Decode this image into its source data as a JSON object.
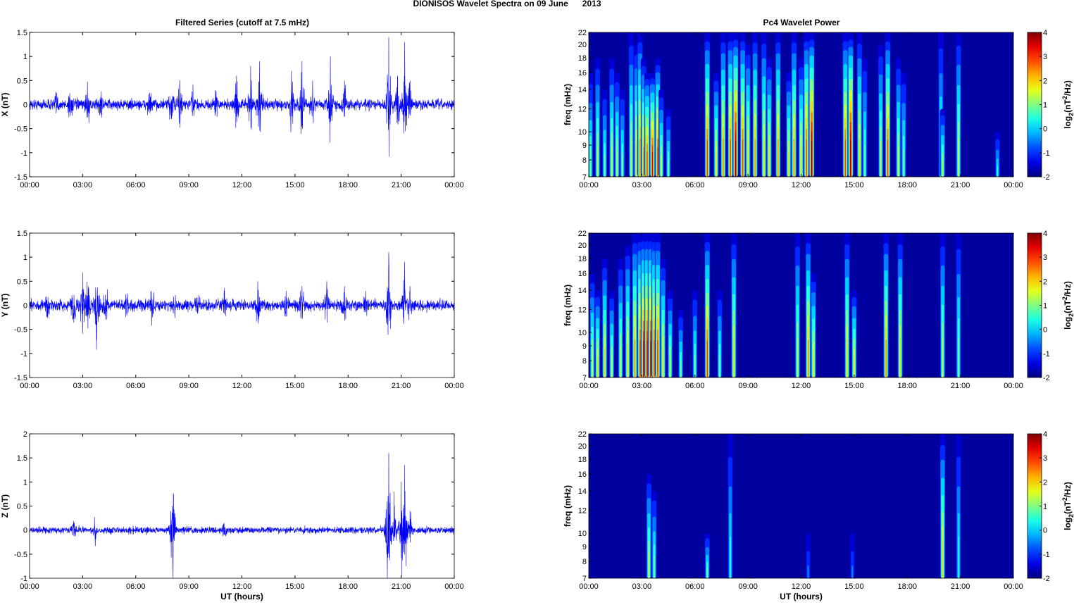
{
  "figure_title": "DIONISOS Wavelet Spectra on 09 June      2013",
  "chart_data": [
    {
      "type": "line",
      "title": "Filtered Series (cutoff at 7.5 mHz)",
      "xlabel": "",
      "ylabel": "X (nT)",
      "xlim": [
        0,
        24
      ],
      "ylim": [
        -1.5,
        1.5
      ],
      "yticks": [
        -1.5,
        -1,
        -0.5,
        0,
        0.5,
        1,
        1.5
      ],
      "xticklabels": [
        "00:00",
        "03:00",
        "06:00",
        "09:00",
        "12:00",
        "15:00",
        "18:00",
        "21:00",
        "00:00"
      ],
      "noise_level": 0.11,
      "color": "#0000ff",
      "bursts": [
        [
          1.5,
          0.3
        ],
        [
          2.3,
          0.4
        ],
        [
          3.3,
          0.45
        ],
        [
          4.0,
          0.3
        ],
        [
          6.8,
          0.3
        ],
        [
          8.0,
          0.5
        ],
        [
          8.5,
          0.8
        ],
        [
          9.2,
          0.4
        ],
        [
          10.5,
          0.3
        ],
        [
          11.7,
          0.6
        ],
        [
          12.5,
          0.8
        ],
        [
          13.0,
          0.9
        ],
        [
          14.8,
          0.7
        ],
        [
          15.4,
          0.9
        ],
        [
          16.0,
          0.5
        ],
        [
          17.0,
          1.0
        ],
        [
          17.8,
          0.5
        ],
        [
          20.3,
          1.4
        ],
        [
          20.8,
          0.6
        ],
        [
          21.2,
          1.3
        ],
        [
          21.5,
          0.5
        ]
      ]
    },
    {
      "type": "line",
      "title": "",
      "xlabel": "",
      "ylabel": "Y (nT)",
      "xlim": [
        0,
        24
      ],
      "ylim": [
        -1.5,
        1.5
      ],
      "yticks": [
        -1.5,
        -1,
        -0.5,
        0,
        0.5,
        1,
        1.5
      ],
      "xticklabels": [
        "00:00",
        "03:00",
        "06:00",
        "09:00",
        "12:00",
        "15:00",
        "18:00",
        "21:00",
        "00:00"
      ],
      "noise_level": 0.11,
      "color": "#0000ff",
      "bursts": [
        [
          1.0,
          0.4
        ],
        [
          2.5,
          0.6
        ],
        [
          3.0,
          0.7
        ],
        [
          3.3,
          0.8
        ],
        [
          3.8,
          1.2
        ],
        [
          4.3,
          0.5
        ],
        [
          5.5,
          0.3
        ],
        [
          6.9,
          0.7
        ],
        [
          8.2,
          0.3
        ],
        [
          9.5,
          0.3
        ],
        [
          11.0,
          0.3
        ],
        [
          12.9,
          0.5
        ],
        [
          14.5,
          0.3
        ],
        [
          15.4,
          0.4
        ],
        [
          16.8,
          0.5
        ],
        [
          17.8,
          0.4
        ],
        [
          19.0,
          0.3
        ],
        [
          20.3,
          1.1
        ],
        [
          21.2,
          0.9
        ],
        [
          21.5,
          0.4
        ]
      ]
    },
    {
      "type": "line",
      "title": "",
      "xlabel": "UT (hours)",
      "ylabel": "Z (nT)",
      "xlim": [
        0,
        24
      ],
      "ylim": [
        -1,
        2
      ],
      "yticks": [
        -1,
        -0.5,
        0,
        0.5,
        1,
        1.5,
        2
      ],
      "xticklabels": [
        "00:00",
        "03:00",
        "06:00",
        "09:00",
        "12:00",
        "15:00",
        "18:00",
        "21:00",
        "00:00"
      ],
      "noise_level": 0.07,
      "color": "#0000ff",
      "bursts": [
        [
          2.5,
          0.2
        ],
        [
          3.7,
          0.3
        ],
        [
          8.1,
          1.4
        ],
        [
          11.0,
          0.15
        ],
        [
          20.2,
          0.6
        ],
        [
          20.3,
          1.6
        ],
        [
          20.6,
          0.8
        ],
        [
          21.0,
          1.0
        ],
        [
          21.2,
          1.35
        ],
        [
          21.5,
          0.4
        ]
      ]
    },
    {
      "type": "heatmap",
      "title": "Pc4 Wavelet Power",
      "xlabel": "",
      "ylabel": "freq (mHz)",
      "xlim": [
        0,
        24
      ],
      "ylim": [
        7,
        22
      ],
      "yticks": [
        7,
        8,
        9,
        10,
        12,
        14,
        16,
        18,
        20,
        22
      ],
      "xticklabels": [
        "00:00",
        "03:00",
        "06:00",
        "09:00",
        "12:00",
        "15:00",
        "18:00",
        "21:00",
        "00:00"
      ],
      "colorbar": {
        "label": "log2(nT^2/Hz)",
        "range": [
          -2,
          4
        ],
        "ticks": [
          -2,
          -1,
          0,
          1,
          2,
          3,
          4
        ]
      },
      "streaks": [
        [
          0.1,
          1,
          16
        ],
        [
          0.5,
          1.5,
          18
        ],
        [
          0.9,
          1,
          14
        ],
        [
          1.3,
          1.5,
          18
        ],
        [
          1.6,
          1.5,
          16
        ],
        [
          1.9,
          1,
          14
        ],
        [
          2.4,
          1.5,
          22
        ],
        [
          2.7,
          2,
          20
        ],
        [
          2.9,
          2.5,
          22
        ],
        [
          3.1,
          2.5,
          18
        ],
        [
          3.3,
          3,
          16
        ],
        [
          3.6,
          3.5,
          16
        ],
        [
          3.9,
          3,
          18
        ],
        [
          4.1,
          1.5,
          14
        ],
        [
          4.5,
          1,
          12
        ],
        [
          6.7,
          3,
          22
        ],
        [
          7.2,
          2,
          16
        ],
        [
          7.6,
          2.5,
          22
        ],
        [
          8.0,
          3,
          22
        ],
        [
          8.3,
          4,
          22
        ],
        [
          8.7,
          3,
          22
        ],
        [
          9.0,
          2,
          20
        ],
        [
          9.4,
          2.5,
          22
        ],
        [
          9.9,
          2,
          22
        ],
        [
          10.2,
          2,
          18
        ],
        [
          10.7,
          2.5,
          22
        ],
        [
          11.3,
          2,
          16
        ],
        [
          11.6,
          2.5,
          22
        ],
        [
          12.0,
          2,
          18
        ],
        [
          12.3,
          3,
          22
        ],
        [
          12.6,
          4,
          22
        ],
        [
          14.5,
          3,
          22
        ],
        [
          14.8,
          4,
          22
        ],
        [
          15.3,
          2,
          22
        ],
        [
          15.6,
          1,
          18
        ],
        [
          16.5,
          1.5,
          20
        ],
        [
          16.9,
          3,
          22
        ],
        [
          17.5,
          1.5,
          18
        ],
        [
          17.8,
          1,
          16
        ],
        [
          19.9,
          1,
          22
        ],
        [
          20.0,
          1.5,
          12
        ],
        [
          20.9,
          1.5,
          22
        ],
        [
          23.1,
          0.5,
          10
        ]
      ]
    },
    {
      "type": "heatmap",
      "title": "",
      "xlabel": "",
      "ylabel": "freq (mHz)",
      "xlim": [
        0,
        24
      ],
      "ylim": [
        7,
        22
      ],
      "yticks": [
        7,
        8,
        9,
        10,
        12,
        14,
        16,
        18,
        20,
        22
      ],
      "xticklabels": [
        "00:00",
        "03:00",
        "06:00",
        "09:00",
        "12:00",
        "15:00",
        "18:00",
        "21:00",
        "00:00"
      ],
      "colorbar": {
        "label": "log2(nT^2/Hz)",
        "range": [
          -2,
          4
        ],
        "ticks": [
          -2,
          -1,
          0,
          1,
          2,
          3,
          4
        ]
      },
      "streaks": [
        [
          0.2,
          1.5,
          16
        ],
        [
          0.5,
          2,
          14
        ],
        [
          0.9,
          2,
          18
        ],
        [
          1.3,
          1.5,
          14
        ],
        [
          1.8,
          1.5,
          18
        ],
        [
          2.2,
          2,
          20
        ],
        [
          2.6,
          2.5,
          22
        ],
        [
          2.9,
          3,
          22
        ],
        [
          3.1,
          3.5,
          22
        ],
        [
          3.3,
          3.5,
          22
        ],
        [
          3.5,
          3.5,
          22
        ],
        [
          3.7,
          3,
          22
        ],
        [
          3.9,
          3,
          22
        ],
        [
          4.2,
          2,
          18
        ],
        [
          4.6,
          1.5,
          14
        ],
        [
          5.2,
          1,
          12
        ],
        [
          6.0,
          1,
          14
        ],
        [
          6.7,
          3,
          22
        ],
        [
          7.4,
          1,
          14
        ],
        [
          8.2,
          2,
          22
        ],
        [
          11.8,
          1.5,
          22
        ],
        [
          12.4,
          2.5,
          22
        ],
        [
          12.7,
          2,
          16
        ],
        [
          14.6,
          2,
          22
        ],
        [
          15.0,
          2,
          14
        ],
        [
          16.8,
          2.5,
          22
        ],
        [
          17.6,
          2,
          22
        ],
        [
          20.0,
          1.5,
          22
        ],
        [
          20.9,
          1,
          22
        ]
      ]
    },
    {
      "type": "heatmap",
      "title": "",
      "xlabel": "UT (hours)",
      "ylabel": "freq (mHz)",
      "xlim": [
        0,
        24
      ],
      "ylim": [
        7,
        22
      ],
      "yticks": [
        7,
        8,
        9,
        10,
        12,
        14,
        16,
        18,
        20,
        22
      ],
      "xticklabels": [
        "00:00",
        "03:00",
        "06:00",
        "09:00",
        "12:00",
        "15:00",
        "18:00",
        "21:00",
        "00:00"
      ],
      "colorbar": {
        "label": "log2(nT^2/Hz)",
        "range": [
          -2,
          4
        ],
        "ticks": [
          -2,
          -1,
          0,
          1,
          2,
          3,
          4
        ]
      },
      "streaks": [
        [
          3.4,
          1.5,
          16
        ],
        [
          3.7,
          1,
          14
        ],
        [
          6.7,
          1,
          10
        ],
        [
          8.0,
          0.5,
          22
        ],
        [
          12.4,
          -0.5,
          10
        ],
        [
          14.9,
          -0.5,
          10
        ],
        [
          20.0,
          2,
          22
        ],
        [
          20.9,
          0.5,
          22
        ]
      ]
    }
  ]
}
